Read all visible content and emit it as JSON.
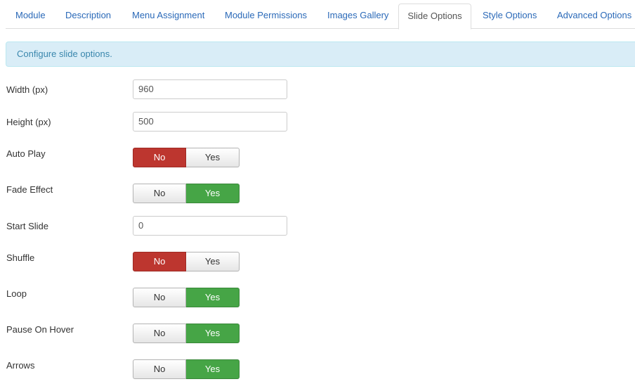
{
  "tabs": [
    {
      "label": "Module",
      "active": false
    },
    {
      "label": "Description",
      "active": false
    },
    {
      "label": "Menu Assignment",
      "active": false
    },
    {
      "label": "Module Permissions",
      "active": false
    },
    {
      "label": "Images Gallery",
      "active": false
    },
    {
      "label": "Slide Options",
      "active": true
    },
    {
      "label": "Style Options",
      "active": false
    },
    {
      "label": "Advanced Options",
      "active": false
    }
  ],
  "info": {
    "message": "Configure slide options."
  },
  "fields": {
    "width": {
      "label": "Width (px)",
      "value": "960"
    },
    "height": {
      "label": "Height (px)",
      "value": "500"
    },
    "auto_play": {
      "label": "Auto Play",
      "no": "No",
      "yes": "Yes",
      "selected": "No"
    },
    "fade_effect": {
      "label": "Fade Effect",
      "no": "No",
      "yes": "Yes",
      "selected": "Yes"
    },
    "start_slide": {
      "label": "Start Slide",
      "value": "0"
    },
    "shuffle": {
      "label": "Shuffle",
      "no": "No",
      "yes": "Yes",
      "selected": "No"
    },
    "loop": {
      "label": "Loop",
      "no": "No",
      "yes": "Yes",
      "selected": "Yes"
    },
    "pause_on_hover": {
      "label": "Pause On Hover",
      "no": "No",
      "yes": "Yes",
      "selected": "Yes"
    },
    "arrows": {
      "label": "Arrows",
      "no": "No",
      "yes": "Yes",
      "selected": "Yes"
    }
  },
  "colors": {
    "link": "#2a69b8",
    "no_active": "#bd362f",
    "yes_active": "#46a546",
    "info_bg": "#d9edf7",
    "info_text": "#3a87ad"
  }
}
